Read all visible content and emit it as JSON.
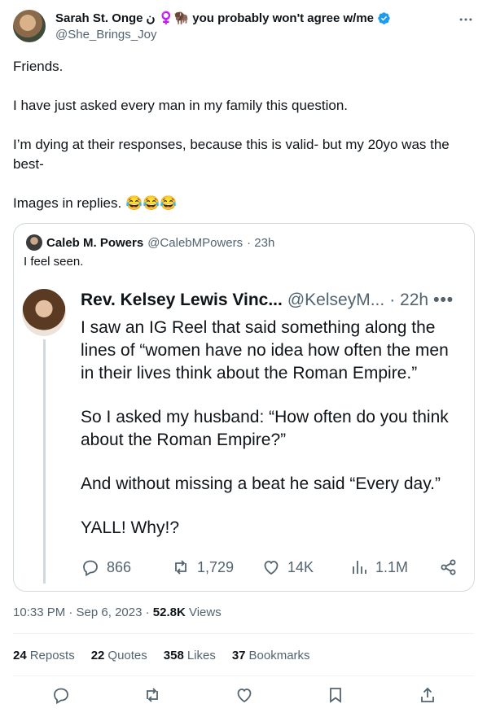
{
  "author": {
    "display_name": "Sarah St. Onge",
    "name_suffix": "ن ♀️🦬 you probably won't agree w/me",
    "handle": "@She_Brings_Joy"
  },
  "tweet_text": [
    "Friends.",
    "I have just asked every man in my family this question.",
    "I’m dying at their responses, because this is valid- but my 20yo was the best-",
    "Images in replies. 😂😂😂"
  ],
  "quote": {
    "name": "Caleb M. Powers",
    "handle": "@CalebMPowers",
    "time": "· 23h",
    "text": "I feel seen.",
    "inner": {
      "name": "Rev. Kelsey Lewis Vinc...",
      "handle": "@KelseyM...",
      "time": "· 22h",
      "more": "•••",
      "text": [
        "I saw an IG Reel that said something along the lines of “women have no idea how often the men in their lives think about the Roman Empire.”",
        "So I asked my husband: “How often do you think about the Roman Empire?”",
        "And without missing a beat he said “Every day.”",
        "YALL! Why!?"
      ],
      "actions": {
        "replies": "866",
        "reposts": "1,729",
        "likes": "14K",
        "views": "1.1M"
      }
    }
  },
  "timestamp": {
    "time_date": "10:33 PM · Sep 6, 2023 ·",
    "views_count": "52.8K",
    "views_label": "Views"
  },
  "stats": {
    "reposts_count": "24",
    "reposts_label": "Reposts",
    "quotes_count": "22",
    "quotes_label": "Quotes",
    "likes_count": "358",
    "likes_label": "Likes",
    "bookmarks_count": "37",
    "bookmarks_label": "Bookmarks"
  },
  "colors": {
    "text": "#0f1419",
    "secondary": "#536471",
    "verified_blue": "#1d9bf0",
    "border": "#cfd9de"
  },
  "icons": [
    "more-icon",
    "verified-icon",
    "reply-icon",
    "repost-icon",
    "like-icon",
    "views-icon",
    "share-icon",
    "bookmark-icon"
  ]
}
